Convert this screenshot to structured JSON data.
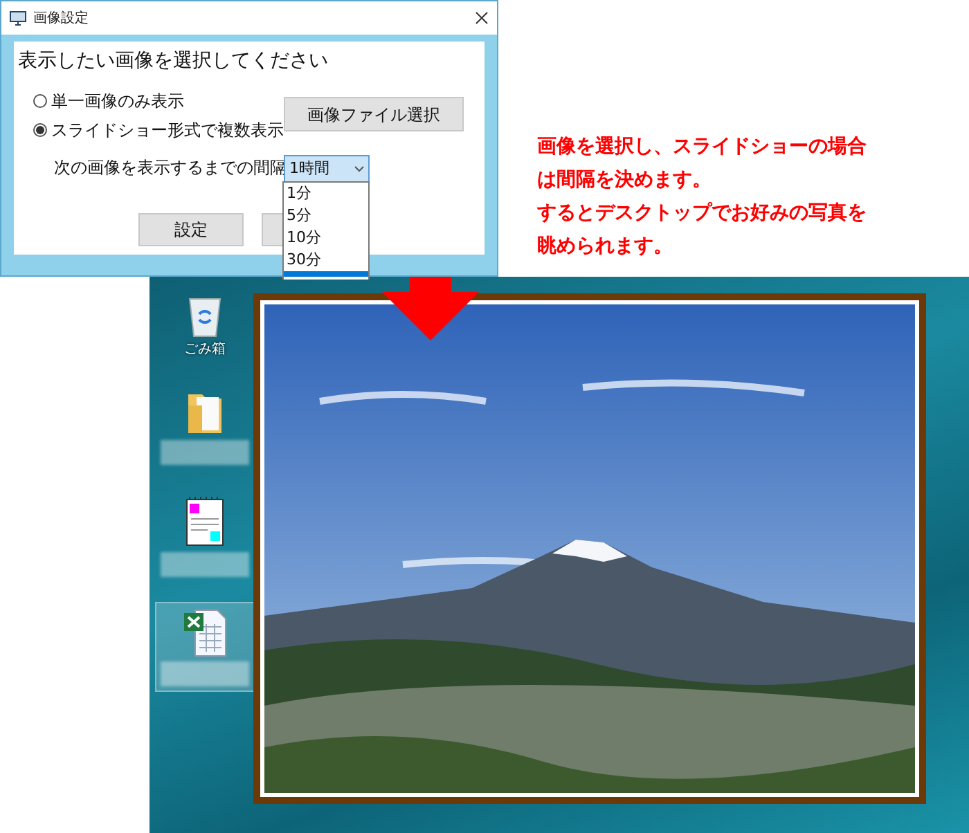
{
  "dialog": {
    "title": "画像設定",
    "heading": "表示したい画像を選択してください",
    "radios": [
      {
        "label": "単一画像のみ表示",
        "selected": false
      },
      {
        "label": "スライドショー形式で複数表示",
        "selected": true
      }
    ],
    "file_button": "画像ファイル選択",
    "interval_label": "次の画像を表示するまでの間隔",
    "interval_select": {
      "value": "1時間",
      "expanded": true,
      "options": [
        {
          "label": "1分",
          "selected": false
        },
        {
          "label": "5分",
          "selected": false
        },
        {
          "label": "10分",
          "selected": false
        },
        {
          "label": "30分",
          "selected": false
        }
      ]
    },
    "buttons": [
      "設定"
    ]
  },
  "note": [
    "画像を選択し、スライドショーの場合",
    "は間隔を決めます。",
    "するとデスクトップでお好みの写真を",
    "眺められます。"
  ],
  "desktop": {
    "icons": [
      {
        "kind": "recycle",
        "label": "ごみ箱",
        "selected": false
      },
      {
        "kind": "folder",
        "selected": false
      },
      {
        "kind": "notepad",
        "selected": false
      },
      {
        "kind": "excel",
        "selected": true
      }
    ]
  }
}
